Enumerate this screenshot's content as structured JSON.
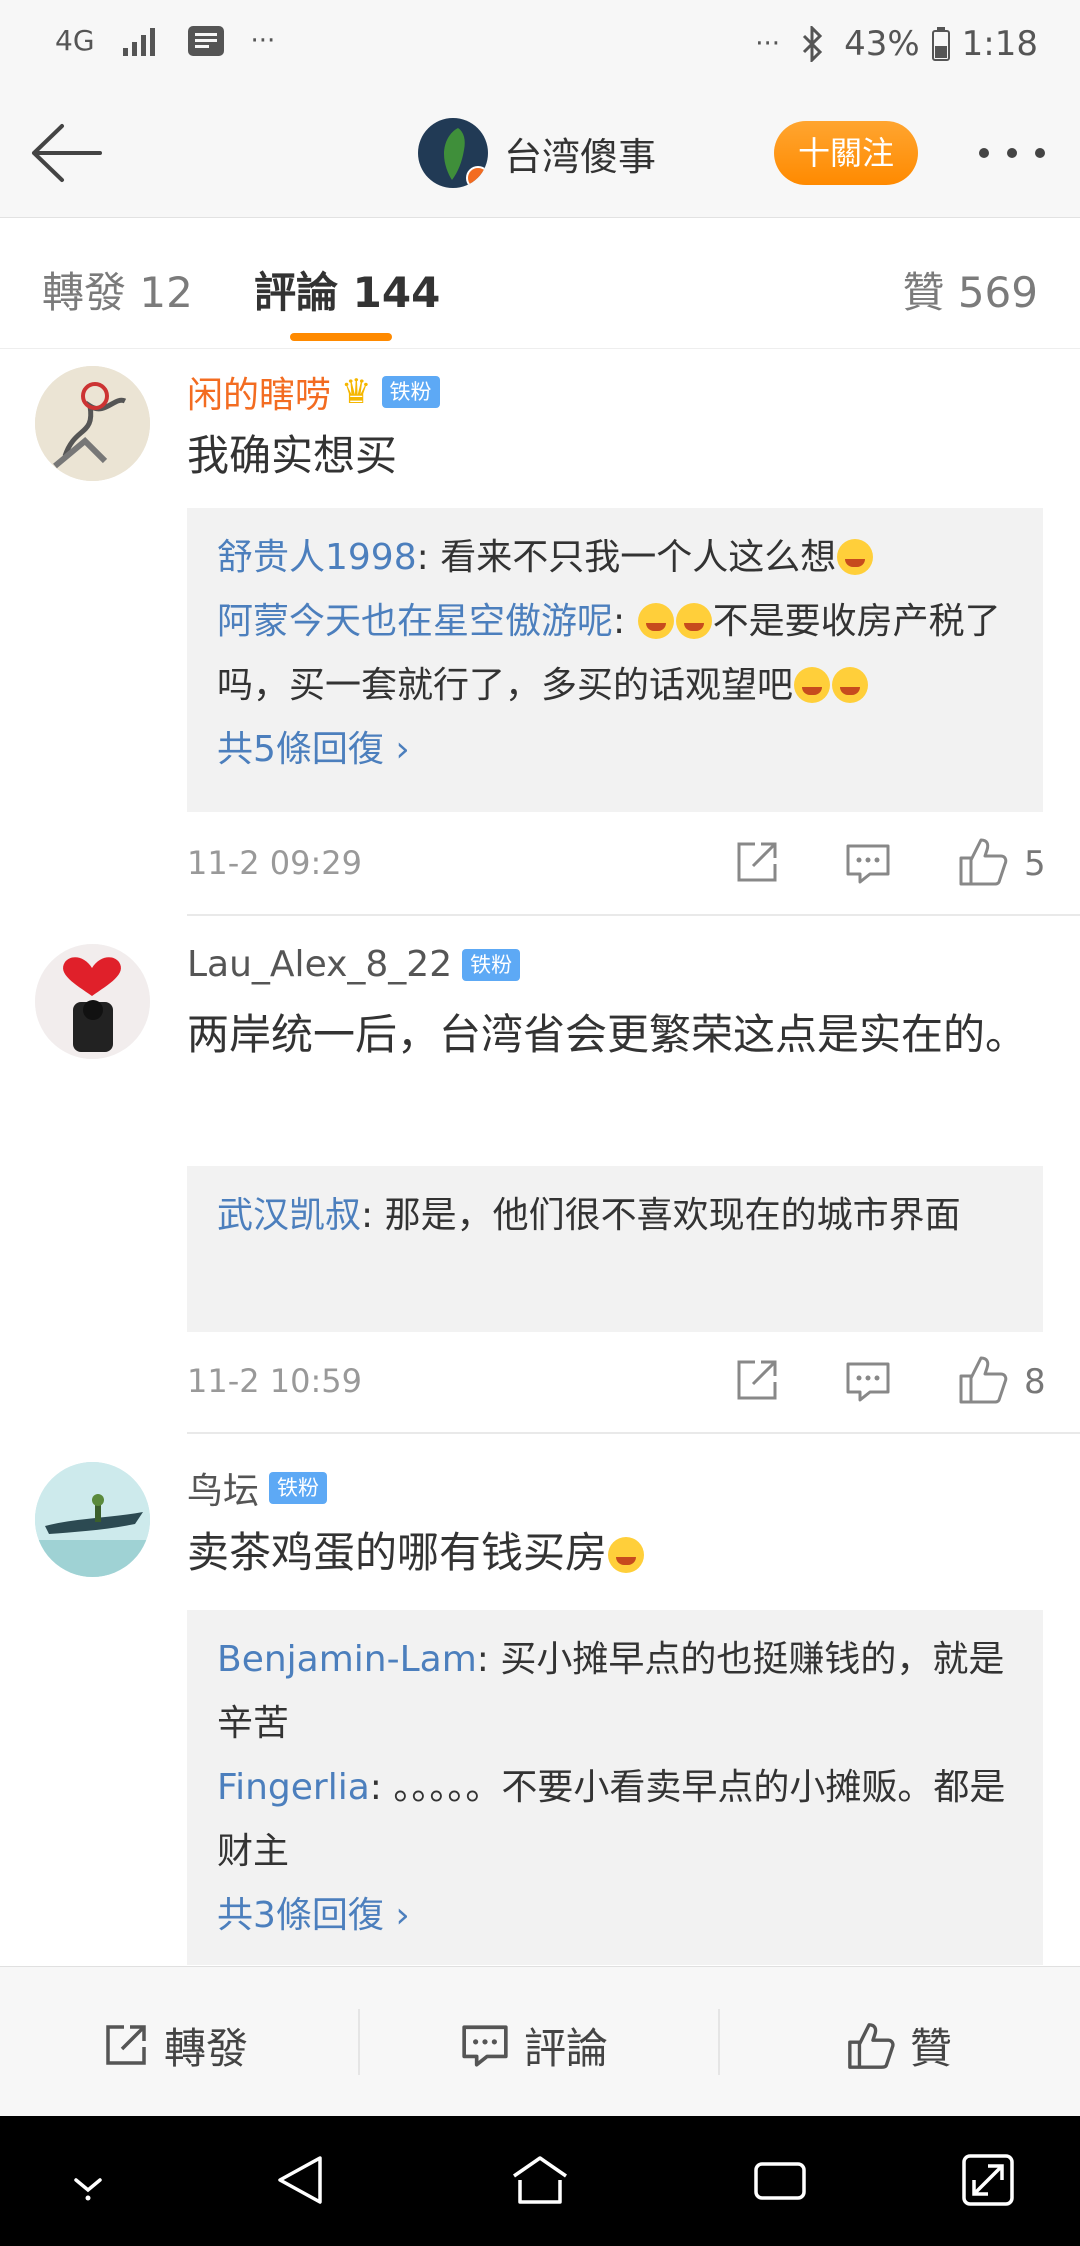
{
  "status_bar": {
    "network": "4G",
    "battery": "43%",
    "time": "1:18",
    "overflow_left": "···",
    "overflow_right": "···"
  },
  "header": {
    "title": "台湾傻事",
    "follow_label": "十關注"
  },
  "tabs": [
    {
      "label": "轉發 12"
    },
    {
      "label": "評論 144"
    },
    {
      "label": "贊 569"
    }
  ],
  "comments": [
    {
      "username": "闲的瞎唠",
      "badge": "铁粉",
      "text": "我确实想买",
      "replies": [
        {
          "name": "舒贵人1998",
          "text": ": 看来不只我一个人这么想"
        },
        {
          "name": "阿蒙今天也在星空傲游呢",
          "text_a": ": ",
          "text_b": "不是要收房产税了吗，买一套就行了，多买的话观望吧"
        }
      ],
      "more_replies": "共5條回復 ›",
      "time": "11-2 09:29",
      "likes": "5"
    },
    {
      "username": "Lau_Alex_8_22",
      "badge": "铁粉",
      "text": "两岸统一后，台湾省会更繁荣这点是实在的。",
      "replies": [
        {
          "name": "武汉凯叔",
          "text": ": 那是，他们很不喜欢现在的城市界面"
        }
      ],
      "time": "11-2 10:59",
      "likes": "8"
    },
    {
      "username": "鸟坛",
      "badge": "铁粉",
      "text": "卖茶鸡蛋的哪有钱买房",
      "replies": [
        {
          "name": "Benjamin-Lam",
          "text": ": 买小摊早点的也挺赚钱的，就是辛苦"
        },
        {
          "name": "Fingerlia",
          "text": ": 。。。。。不要小看卖早点的小摊贩。都是财主"
        }
      ],
      "more_replies": "共3條回復 ›"
    }
  ],
  "bottom_bar": {
    "repost": "轉發",
    "comment": "評論",
    "like": "贊"
  },
  "colors": {
    "accent": "#ff8a00",
    "link": "#4c7fbd",
    "badge": "#5da9f5",
    "vip_name": "#f36c21"
  }
}
